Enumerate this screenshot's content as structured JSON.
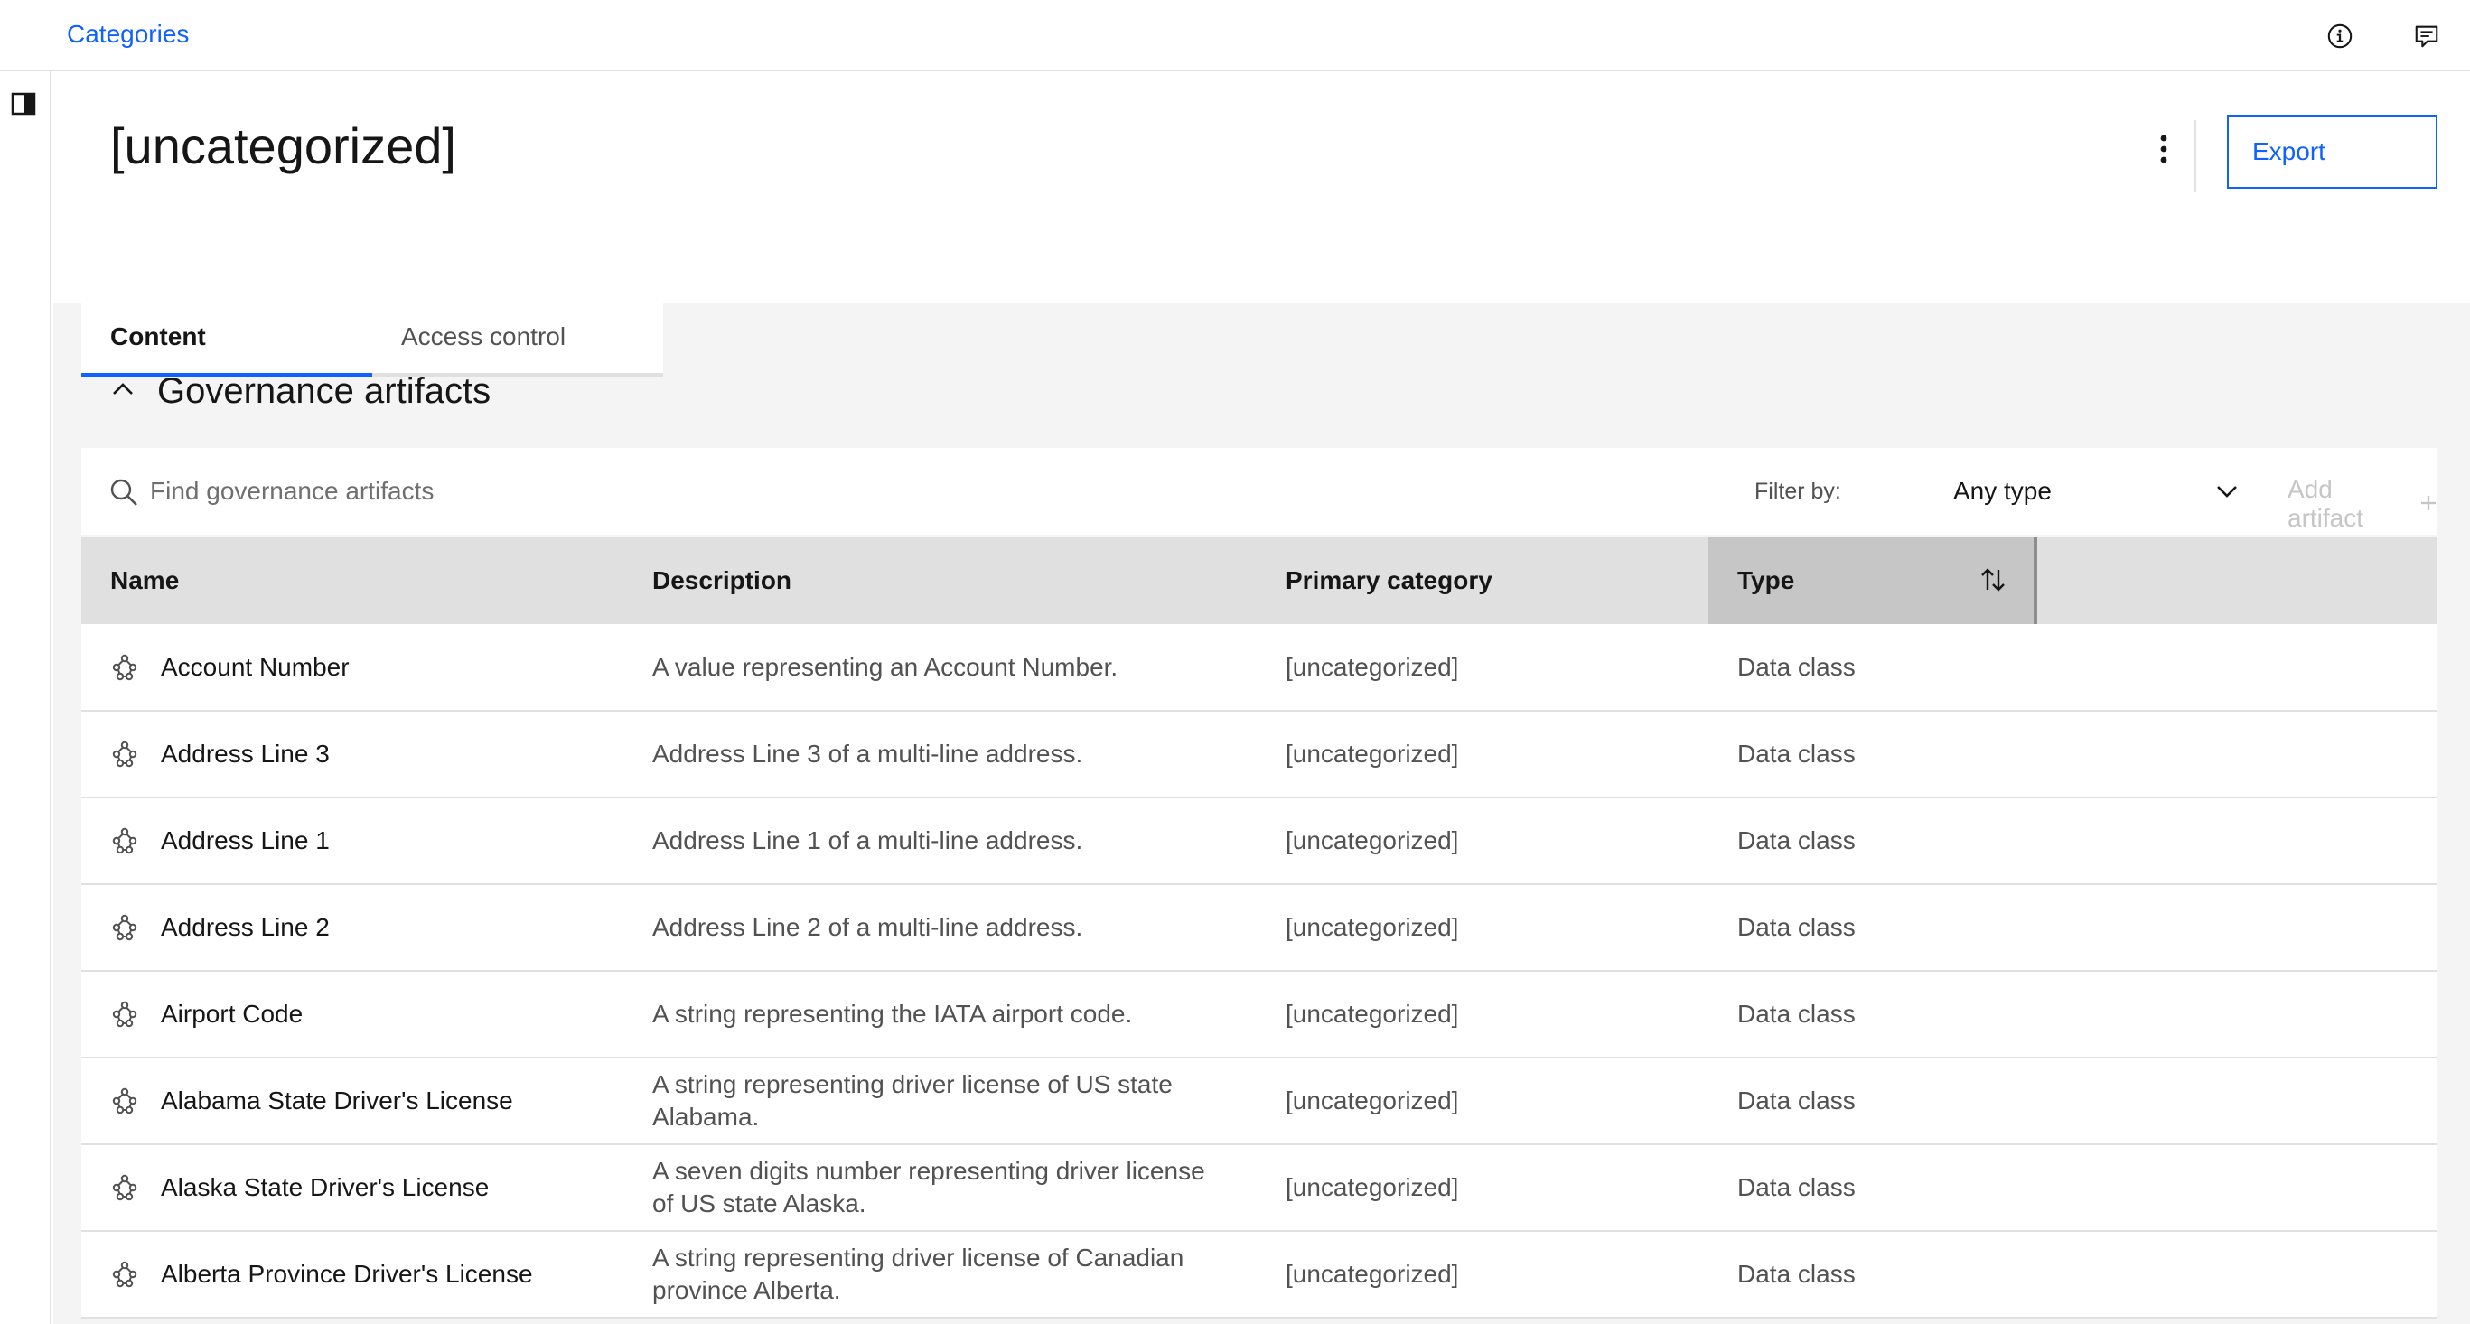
{
  "header": {
    "breadcrumb": "Categories",
    "info_icon": "information-icon",
    "feedback_icon": "chat-feedback-icon"
  },
  "sidebar": {
    "toggle_icon": "side-panel-toggle-icon"
  },
  "page": {
    "title": "[uncategorized]",
    "overflow_icon": "overflow-menu-vertical-icon",
    "export_label": "Export"
  },
  "tabs": [
    {
      "label": "Content",
      "active": true
    },
    {
      "label": "Access control",
      "active": false
    }
  ],
  "section": {
    "title": "Governance artifacts",
    "collapse_icon": "chevron-up-icon"
  },
  "toolbar": {
    "search_placeholder": "Find governance artifacts",
    "filter_label": "Filter by:",
    "filter_value": "Any type",
    "add_label": "Add artifact"
  },
  "table": {
    "columns": [
      "Name",
      "Description",
      "Primary category",
      "Type"
    ],
    "sorted_column": "Type",
    "rows": [
      {
        "name": "Account Number",
        "description": "A value representing an Account Number.",
        "category": "[uncategorized]",
        "type": "Data class"
      },
      {
        "name": "Address Line 3",
        "description": "Address Line 3 of a multi-line address.",
        "category": "[uncategorized]",
        "type": "Data class"
      },
      {
        "name": "Address Line 1",
        "description": "Address Line 1 of a multi-line address.",
        "category": "[uncategorized]",
        "type": "Data class"
      },
      {
        "name": "Address Line 2",
        "description": "Address Line 2 of a multi-line address.",
        "category": "[uncategorized]",
        "type": "Data class"
      },
      {
        "name": "Airport Code",
        "description": "A string representing the IATA airport code.",
        "category": "[uncategorized]",
        "type": "Data class"
      },
      {
        "name": "Alabama State Driver's License",
        "description": "A string representing driver license of US state Alabama.",
        "category": "[uncategorized]",
        "type": "Data class"
      },
      {
        "name": "Alaska State Driver's License",
        "description": "A seven digits number representing driver license of US state Alaska.",
        "category": "[uncategorized]",
        "type": "Data class"
      },
      {
        "name": "Alberta Province Driver's License",
        "description": "A string representing driver license of Canadian province Alberta.",
        "category": "[uncategorized]",
        "type": "Data class"
      }
    ]
  },
  "colors": {
    "accent": "#0f62fe",
    "header_bg": "#e0e0e0",
    "content_bg": "#f4f4f4"
  }
}
